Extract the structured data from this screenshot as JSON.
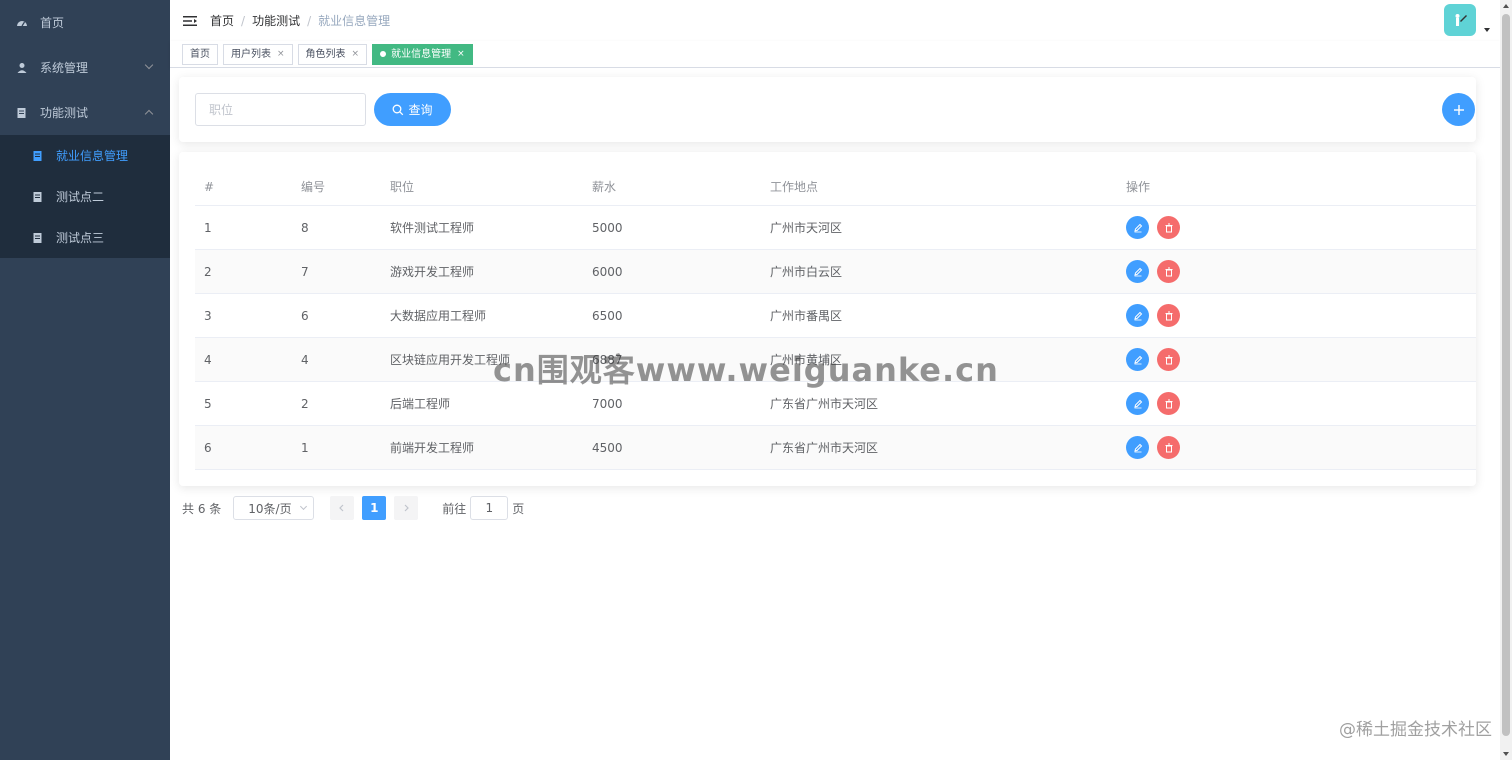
{
  "sidebar": {
    "items": [
      {
        "label": "首页",
        "icon": "dashboard-icon"
      },
      {
        "label": "系统管理",
        "icon": "user-icon"
      },
      {
        "label": "功能测试",
        "icon": "document-icon"
      }
    ],
    "submenu": [
      {
        "label": "就业信息管理",
        "icon": "document-icon",
        "active": true
      },
      {
        "label": "测试点二",
        "icon": "document-icon"
      },
      {
        "label": "测试点三",
        "icon": "document-icon"
      }
    ]
  },
  "navbar": {
    "breadcrumb": [
      "首页",
      "功能测试",
      "就业信息管理"
    ],
    "separator": "/"
  },
  "tags": [
    {
      "label": "首页"
    },
    {
      "label": "用户列表",
      "close": "×"
    },
    {
      "label": "角色列表",
      "close": "×"
    },
    {
      "label": "就业信息管理",
      "close": "×",
      "active": true
    }
  ],
  "search": {
    "placeholder": "职位",
    "button_label": "查询"
  },
  "table": {
    "headers": [
      "#",
      "编号",
      "职位",
      "薪水",
      "工作地点",
      "操作"
    ],
    "rows": [
      [
        "1",
        "8",
        "软件测试工程师",
        "5000",
        "广州市天河区"
      ],
      [
        "2",
        "7",
        "游戏开发工程师",
        "6000",
        "广州市白云区"
      ],
      [
        "3",
        "6",
        "大数据应用工程师",
        "6500",
        "广州市番禺区"
      ],
      [
        "4",
        "4",
        "区块链应用开发工程师",
        "6887",
        "广州市黄埔区"
      ],
      [
        "5",
        "2",
        "后端工程师",
        "7000",
        "广东省广州市天河区"
      ],
      [
        "6",
        "1",
        "前端开发工程师",
        "4500",
        "广东省广州市天河区"
      ]
    ]
  },
  "pagination": {
    "total": "共 6 条",
    "page_size": "10条/页",
    "current_page": "1",
    "goto_prefix": "前往",
    "goto_value": "1",
    "goto_suffix": "页"
  },
  "watermark": "cn围观客www.weiguanke.cn",
  "watermark2": "@稀土掘金技术社区",
  "colors": {
    "sidebar_bg": "#304156",
    "submenu_bg": "#1f2d3d",
    "primary": "#409eff",
    "danger": "#f56c6c",
    "tag_active": "#42b983"
  }
}
